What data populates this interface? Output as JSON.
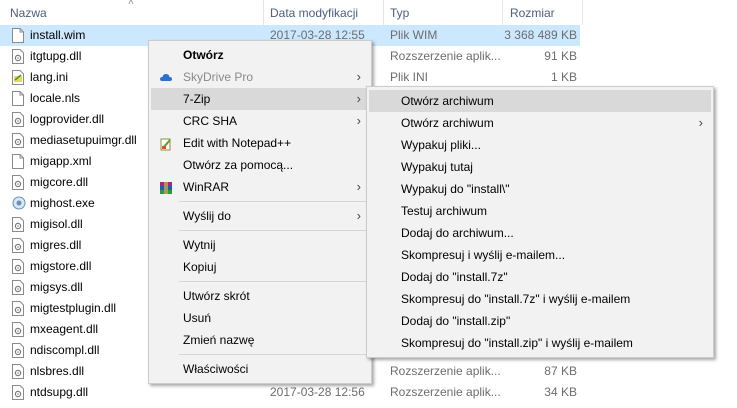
{
  "header": {
    "name": "Nazwa",
    "date": "Data modyfikacji",
    "type": "Typ",
    "size": "Rozmiar"
  },
  "files": [
    {
      "name": "install.wim",
      "date": "2017-03-28 12:55",
      "type": "Plik WIM",
      "size": "3 368 489 KB",
      "icon": "file-icon",
      "selected": true
    },
    {
      "name": "itgtupg.dll",
      "date": "",
      "type": "Rozszerzenie aplik...",
      "size": "91 KB",
      "icon": "gear-file-icon"
    },
    {
      "name": "lang.ini",
      "date": "",
      "type": "Plik INI",
      "size": "1 KB",
      "icon": "ini-file-icon"
    },
    {
      "name": "locale.nls",
      "date": "",
      "type": "",
      "size": "",
      "icon": "file-icon"
    },
    {
      "name": "logprovider.dll",
      "date": "",
      "type": "",
      "size": "",
      "icon": "gear-file-icon"
    },
    {
      "name": "mediasetupuimgr.dll",
      "date": "",
      "type": "",
      "size": "",
      "icon": "gear-file-icon"
    },
    {
      "name": "migapp.xml",
      "date": "",
      "type": "",
      "size": "",
      "icon": "file-icon"
    },
    {
      "name": "migcore.dll",
      "date": "",
      "type": "",
      "size": "",
      "icon": "gear-file-icon"
    },
    {
      "name": "mighost.exe",
      "date": "",
      "type": "",
      "size": "",
      "icon": "exe-icon"
    },
    {
      "name": "migisol.dll",
      "date": "",
      "type": "",
      "size": "",
      "icon": "gear-file-icon"
    },
    {
      "name": "migres.dll",
      "date": "",
      "type": "",
      "size": "",
      "icon": "gear-file-icon"
    },
    {
      "name": "migstore.dll",
      "date": "",
      "type": "",
      "size": "",
      "icon": "gear-file-icon"
    },
    {
      "name": "migsys.dll",
      "date": "",
      "type": "",
      "size": "",
      "icon": "gear-file-icon"
    },
    {
      "name": "migtestplugin.dll",
      "date": "",
      "type": "",
      "size": "",
      "icon": "gear-file-icon"
    },
    {
      "name": "mxeagent.dll",
      "date": "",
      "type": "",
      "size": "",
      "icon": "gear-file-icon"
    },
    {
      "name": "ndiscompl.dll",
      "date": "",
      "type": "",
      "size": "",
      "icon": "gear-file-icon"
    },
    {
      "name": "nlsbres.dll",
      "date": "",
      "type": "Rozszerzenie aplik...",
      "size": "87 KB",
      "icon": "gear-file-icon"
    },
    {
      "name": "ntdsupg.dll",
      "date": "2017-03-28 12:56",
      "type": "Rozszerzenie aplik...",
      "size": "34 KB",
      "icon": "gear-file-icon"
    }
  ],
  "context_menu": {
    "items": [
      {
        "label": "Otwórz",
        "bold": true
      },
      {
        "label": "SkyDrive Pro",
        "icon": "skydrive-icon",
        "submenu": true,
        "disabled": true
      },
      {
        "label": "7-Zip",
        "submenu": true,
        "highlighted": true
      },
      {
        "label": "CRC SHA",
        "submenu": true
      },
      {
        "label": "Edit with Notepad++",
        "icon": "notepad-icon"
      },
      {
        "label": "Otwórz za pomocą..."
      },
      {
        "label": "WinRAR",
        "icon": "winrar-icon",
        "submenu": true
      },
      {
        "separator": true
      },
      {
        "label": "Wyślij do",
        "submenu": true
      },
      {
        "separator": true
      },
      {
        "label": "Wytnij"
      },
      {
        "label": "Kopiuj"
      },
      {
        "separator": true
      },
      {
        "label": "Utwórz skrót"
      },
      {
        "label": "Usuń"
      },
      {
        "label": "Zmień nazwę"
      },
      {
        "separator": true
      },
      {
        "label": "Właściwości"
      }
    ]
  },
  "submenu_7zip": {
    "items": [
      {
        "label": "Otwórz archiwum",
        "highlighted": true
      },
      {
        "label": "Otwórz archiwum",
        "submenu": true
      },
      {
        "label": "Wypakuj pliki..."
      },
      {
        "label": "Wypakuj tutaj"
      },
      {
        "label": "Wypakuj do \"install\\\""
      },
      {
        "label": "Testuj archiwum"
      },
      {
        "label": "Dodaj do archiwum..."
      },
      {
        "label": "Skompresuj i wyślij e-mailem..."
      },
      {
        "label": "Dodaj do \"install.7z\""
      },
      {
        "label": "Skompresuj do \"install.7z\" i wyślij e-mailem"
      },
      {
        "label": "Dodaj do \"install.zip\""
      },
      {
        "label": "Skompresuj do \"install.zip\" i wyślij e-mailem"
      }
    ]
  },
  "colors": {
    "selection": "#cce8ff",
    "menu_bg": "#f2f2f2",
    "menu_highlight": "#d9d9d9",
    "header_text": "#4c607a",
    "secondary_text": "#6d6d6d"
  }
}
